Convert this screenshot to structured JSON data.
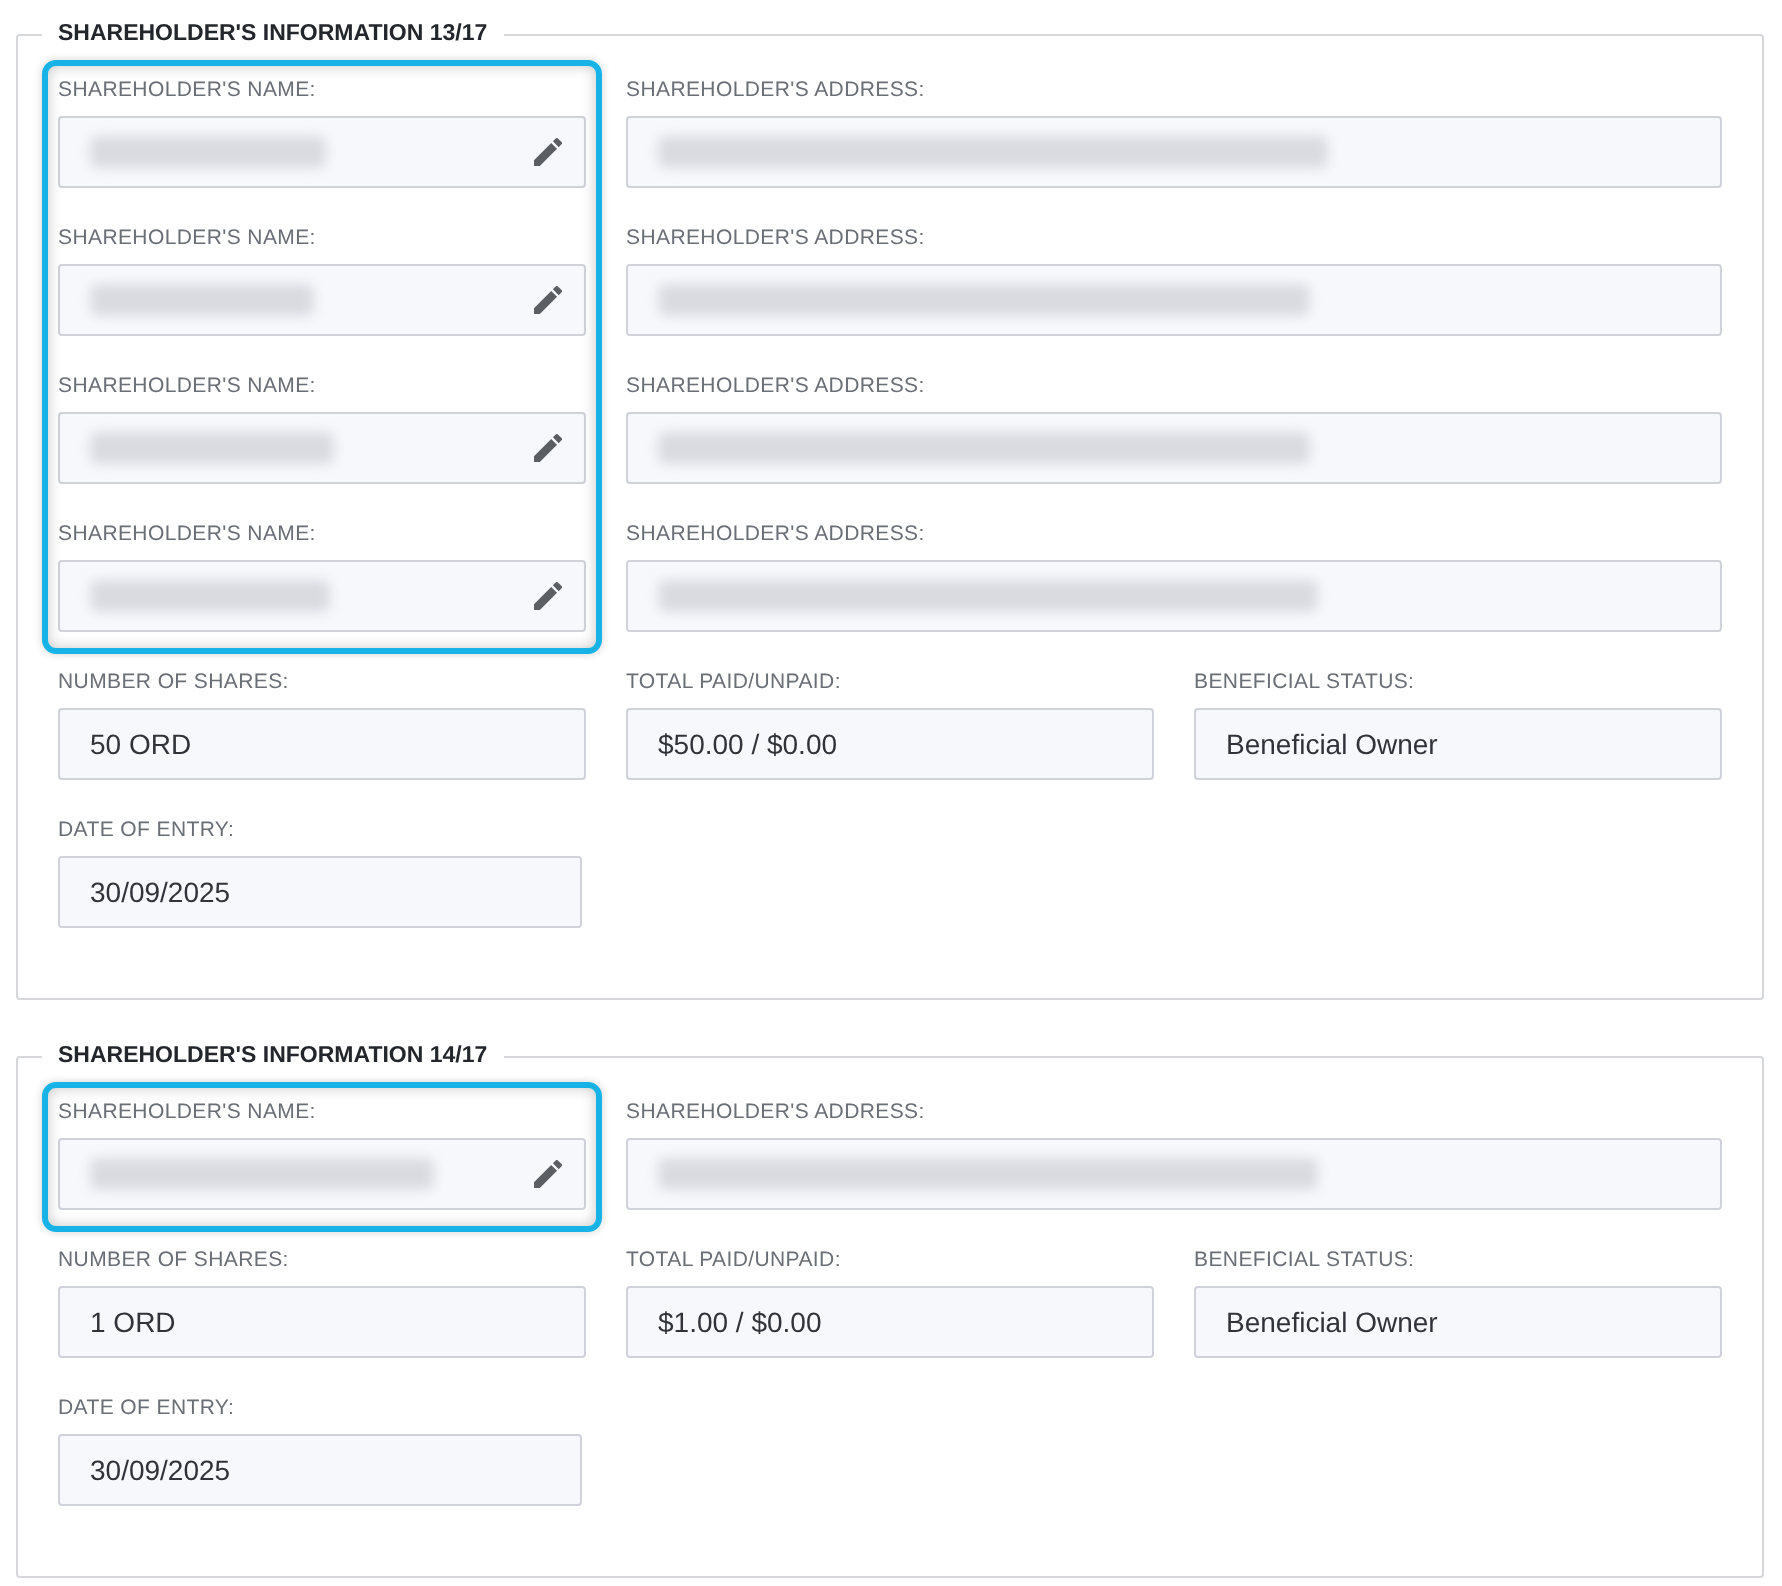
{
  "sections": [
    {
      "title": "SHAREHOLDER'S INFORMATION 13/17",
      "names_highlighted": true,
      "holders": [
        {
          "name_label": "SHAREHOLDER'S NAME:",
          "name_blurred": true,
          "name_editable": true,
          "address_label": "SHAREHOLDER'S ADDRESS:",
          "address_blurred": true
        },
        {
          "name_label": "SHAREHOLDER'S NAME:",
          "name_blurred": true,
          "name_editable": true,
          "address_label": "SHAREHOLDER'S ADDRESS:",
          "address_blurred": true
        },
        {
          "name_label": "SHAREHOLDER'S NAME:",
          "name_blurred": true,
          "name_editable": true,
          "address_label": "SHAREHOLDER'S ADDRESS:",
          "address_blurred": true
        },
        {
          "name_label": "SHAREHOLDER'S NAME:",
          "name_blurred": true,
          "name_editable": true,
          "address_label": "SHAREHOLDER'S ADDRESS:",
          "address_blurred": true
        }
      ],
      "fields": [
        {
          "label": "NUMBER OF SHARES:",
          "value": "50 ORD"
        },
        {
          "label": "TOTAL PAID/UNPAID:",
          "value": "$50.00 / $0.00"
        },
        {
          "label": "BENEFICIAL STATUS:",
          "value": "Beneficial Owner"
        },
        {
          "label": "DATE OF ENTRY:",
          "value": "30/09/2025"
        }
      ]
    },
    {
      "title": "SHAREHOLDER'S INFORMATION 14/17",
      "names_highlighted": true,
      "holders": [
        {
          "name_label": "SHAREHOLDER'S NAME:",
          "name_blurred": true,
          "name_editable": true,
          "address_label": "SHAREHOLDER'S ADDRESS:",
          "address_blurred": true
        }
      ],
      "fields": [
        {
          "label": "NUMBER OF SHARES:",
          "value": "1 ORD"
        },
        {
          "label": "TOTAL PAID/UNPAID:",
          "value": "$1.00 / $0.00"
        },
        {
          "label": "BENEFICIAL STATUS:",
          "value": "Beneficial Owner"
        },
        {
          "label": "DATE OF ENTRY:",
          "value": "30/09/2025"
        }
      ]
    }
  ]
}
